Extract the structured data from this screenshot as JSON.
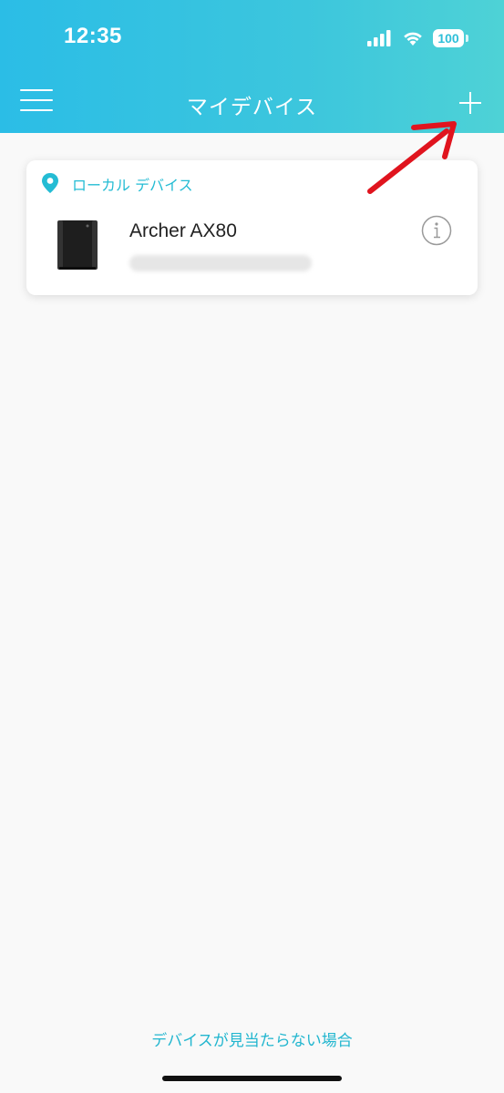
{
  "status_bar": {
    "time": "12:35",
    "battery": "100"
  },
  "header": {
    "title": "マイデバイス",
    "menu_icon": "hamburger-icon",
    "add_icon": "plus-icon"
  },
  "device_card": {
    "section_label": "ローカル デバイス",
    "devices": [
      {
        "name": "Archer AX80",
        "icon": "router-icon"
      }
    ]
  },
  "footer": {
    "help_link": "デバイスが見当たらない場合"
  },
  "colors": {
    "accent": "#24bcd4",
    "annotation_arrow": "#e0141e"
  }
}
